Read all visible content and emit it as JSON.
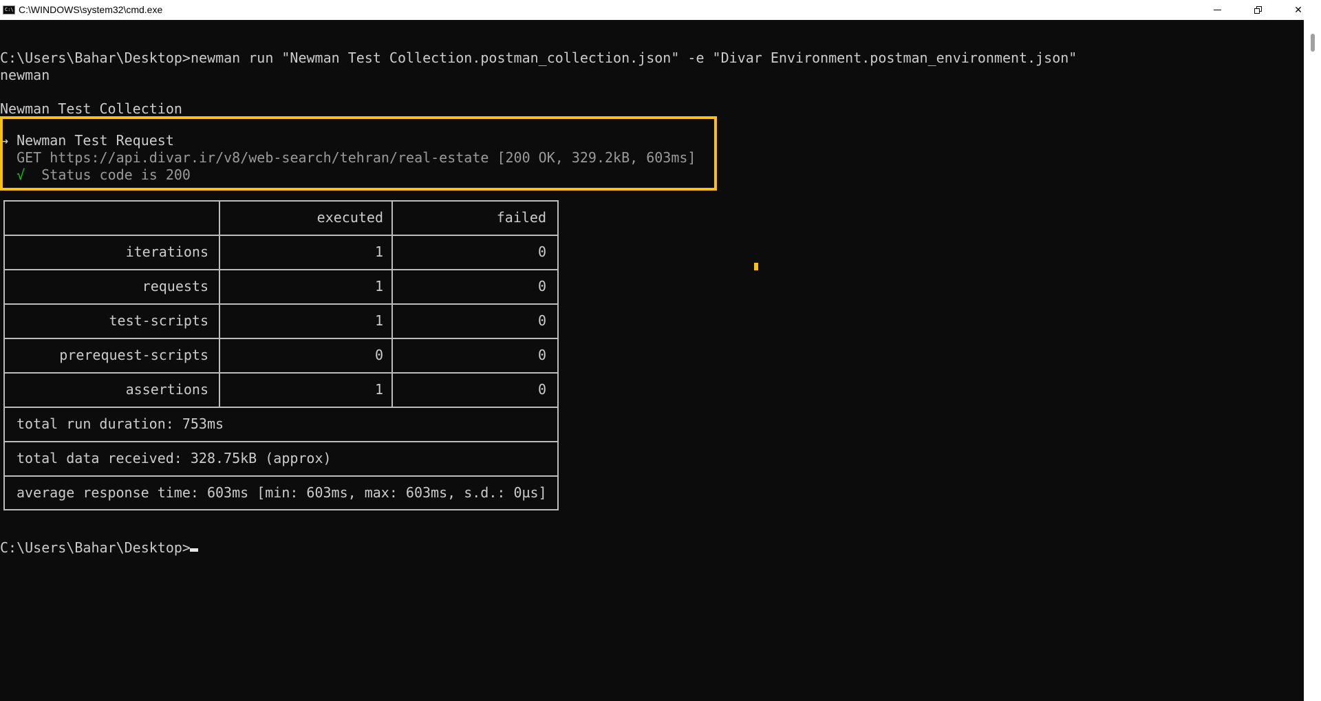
{
  "window": {
    "title": "C:\\WINDOWS\\system32\\cmd.exe",
    "icon_text": "C:\\",
    "controls": {
      "minimize": "minimize-icon",
      "restore": "restore-icon",
      "close": "✕"
    }
  },
  "console": {
    "command_line": "C:\\Users\\Bahar\\Desktop>newman run \"Newman Test Collection.postman_collection.json\" -e \"Divar Environment.postman_environment.json\"",
    "tool_name": "newman",
    "collection_name": "Newman Test Collection",
    "request": {
      "arrow": "→",
      "name": "Newman Test Request",
      "detail": "GET https://api.divar.ir/v8/web-search/tehran/real-estate [200 OK, 329.2kB, 603ms]",
      "check_mark": "√",
      "assertion": "Status code is 200"
    },
    "summary": {
      "headers": {
        "label": "",
        "executed": "executed",
        "failed": "failed"
      },
      "rows": [
        {
          "label": "iterations",
          "executed": "1",
          "failed": "0"
        },
        {
          "label": "requests",
          "executed": "1",
          "failed": "0"
        },
        {
          "label": "test-scripts",
          "executed": "1",
          "failed": "0"
        },
        {
          "label": "prerequest-scripts",
          "executed": "0",
          "failed": "0"
        },
        {
          "label": "assertions",
          "executed": "1",
          "failed": "0"
        }
      ],
      "total_run_duration": "total run duration: 753ms",
      "total_data_received": "total data received: 328.75kB (approx)",
      "average_response_time": "average response time: 603ms [min: 603ms, max: 603ms, s.d.: 0µs]"
    },
    "prompt": "C:\\Users\\Bahar\\Desktop>"
  },
  "colors": {
    "background": "#0c0c0c",
    "text": "#cccccc",
    "dim_text": "#9a9a9a",
    "green": "#16c60c",
    "highlight": "#fbbf17"
  }
}
